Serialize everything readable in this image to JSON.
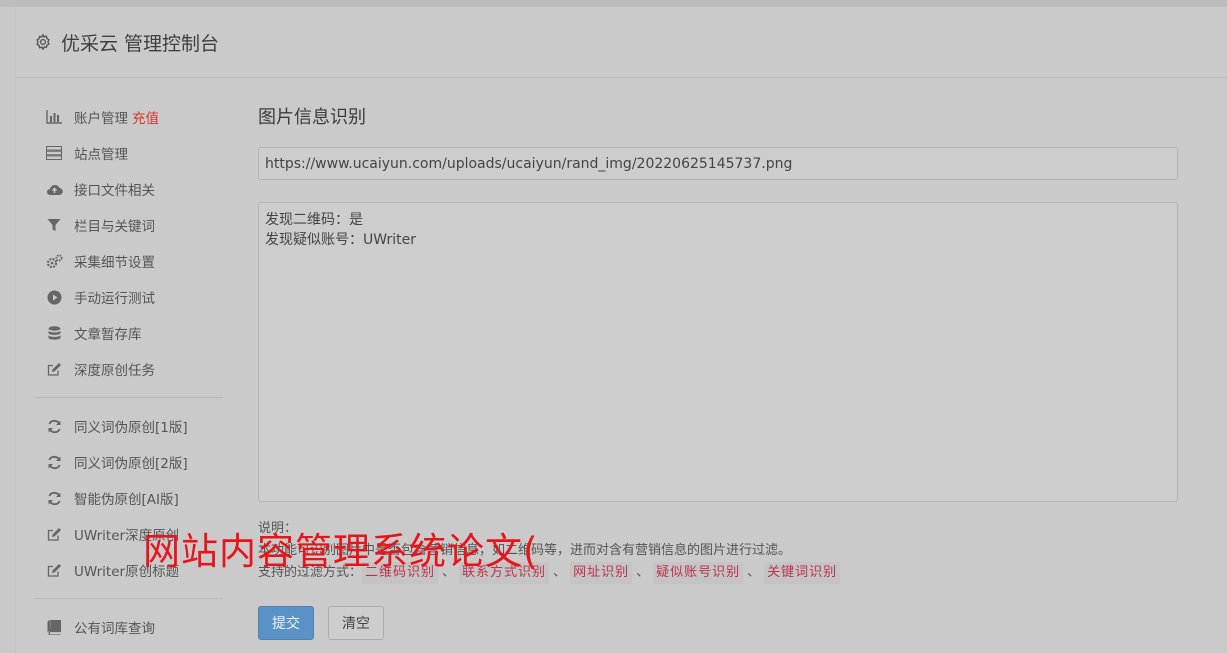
{
  "header": {
    "title": "优采云 管理控制台",
    "icon": "gear-icon"
  },
  "sidebar": {
    "groups": [
      [
        {
          "label": "账户管理",
          "badge": "充值",
          "icon": "bar-chart-icon"
        },
        {
          "label": "站点管理",
          "icon": "server-icon"
        },
        {
          "label": "接口文件相关",
          "icon": "cloud-upload-icon"
        },
        {
          "label": "栏目与关键词",
          "icon": "filter-icon"
        },
        {
          "label": "采集细节设置",
          "icon": "cogs-icon"
        },
        {
          "label": "手动运行测试",
          "icon": "play-circle-icon"
        },
        {
          "label": "文章暂存库",
          "icon": "database-icon"
        },
        {
          "label": "深度原创任务",
          "icon": "edit-icon"
        }
      ],
      [
        {
          "label": "同义词伪原创[1版]",
          "icon": "refresh-icon"
        },
        {
          "label": "同义词伪原创[2版]",
          "icon": "refresh-icon"
        },
        {
          "label": "智能伪原创[AI版]",
          "icon": "refresh-icon"
        },
        {
          "label": "UWriter深度原创",
          "icon": "edit-icon"
        },
        {
          "label": "UWriter原创标题",
          "icon": "edit-icon"
        }
      ],
      [
        {
          "label": "公有词库查询",
          "icon": "book-icon"
        }
      ]
    ]
  },
  "main": {
    "title": "图片信息识别",
    "url_value": "https://www.ucaiyun.com/uploads/ucaiyun/rand_img/20220625145737.png",
    "result_text": "发现二维码：是\n发现疑似账号：UWriter",
    "notes": {
      "heading": "说明：",
      "line1": "本功能可识别图片中是否包含营销信息，如二维码等，进而对含有营销信息的图片进行过滤。",
      "filter_label": "支持的过滤方式：",
      "filters": [
        "二维码识别",
        "联系方式识别",
        "网址识别",
        "疑似账号识别",
        "关键词识别"
      ],
      "separator": "、"
    },
    "buttons": {
      "submit": "提交",
      "clear": "清空"
    }
  },
  "watermark": {
    "text": "网站内容管理系统论文("
  },
  "colors": {
    "accent": "#5a91c7",
    "badge": "#d9342b",
    "filter_tag": "#c0304e",
    "watermark": "#e8141b"
  }
}
